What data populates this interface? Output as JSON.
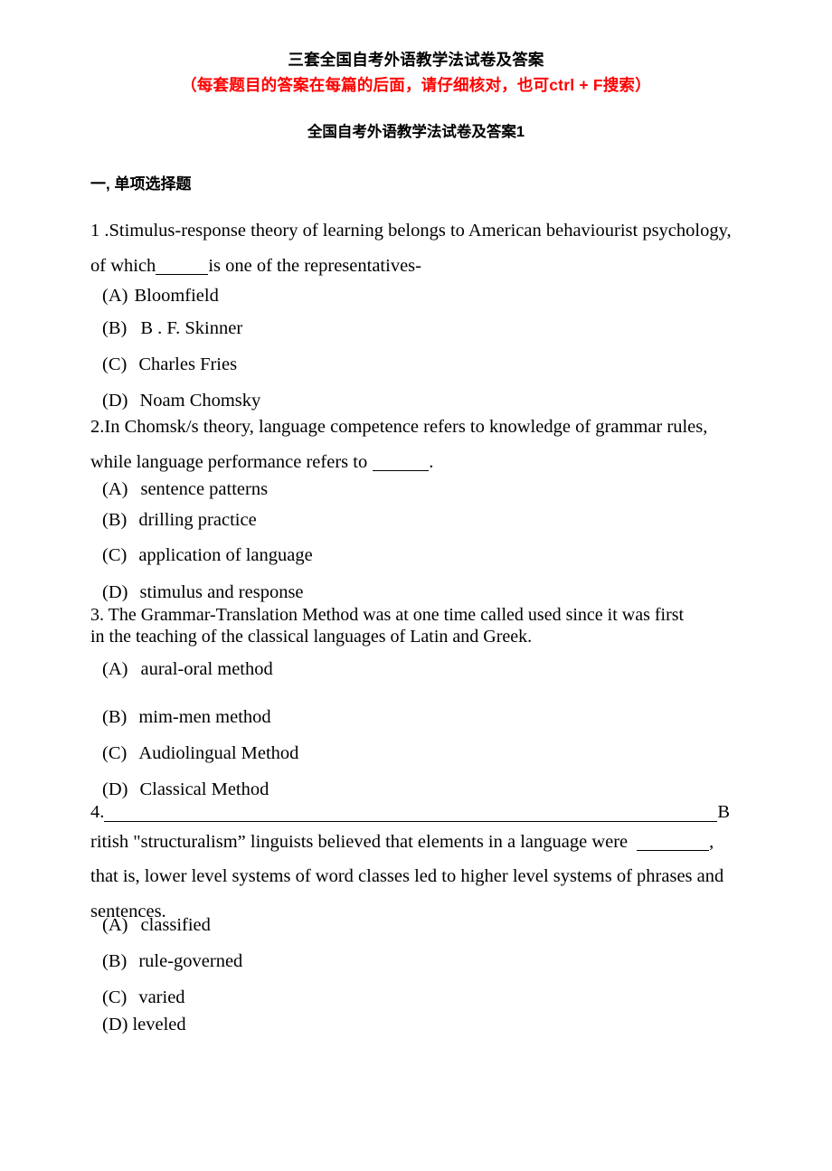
{
  "document": {
    "title": "三套全国自考外语教学法试卷及答案",
    "subnote": "（每套题目的答案在每篇的后面，请仔细核对，也可ctrl + F搜索）",
    "paper_heading": "全国自考外语教学法试卷及答案1",
    "section_heading": "一, 单项选择题"
  },
  "questions": [
    {
      "number": "1",
      "stem_line1": "1 .Stimulus-response theory of learning belongs to American behaviourist psychology,",
      "stem_line2_before": "of which",
      "stem_line2_after": "is one of the representatives-",
      "options": [
        {
          "label": "(A)",
          "text": "Bloomfield"
        },
        {
          "label": "(B)",
          "text": "B . F. Skinner"
        },
        {
          "label": "(C)",
          "text": "Charles Fries"
        },
        {
          "label": "(D)",
          "text": "Noam Chomsky"
        }
      ]
    },
    {
      "number": "2",
      "stem_line1": "2.In Chomsk/s theory, language competence refers to knowledge of grammar rules,",
      "stem_line2_before": "while language performance refers to",
      "stem_line2_after": ".",
      "options": [
        {
          "label": "(A)",
          "text": "sentence patterns"
        },
        {
          "label": "(B)",
          "text": "drilling practice"
        },
        {
          "label": "(C)",
          "text": "application of language"
        },
        {
          "label": "(D)",
          "text": "stimulus and response"
        }
      ]
    },
    {
      "number": "3",
      "stem_line1": "3.   The Grammar-Translation Method was at one time called used    since it was first",
      "stem_line2": "in the teaching of the classical languages of Latin and Greek.",
      "options": [
        {
          "label": "(A)",
          "text": "aural-oral method"
        },
        {
          "label": "(B)",
          "text": "mim-men method"
        },
        {
          "label": "(C)",
          "text": "Audiolingual Method"
        },
        {
          "label": "(D)",
          "text": "Classical Method"
        }
      ]
    },
    {
      "number": "4",
      "stem_line1_prefix": "4.",
      "stem_line1_suffix": "B",
      "stem_line2_before": "ritish \"structuralism” linguists believed that elements in a language were",
      "stem_line2_after": ",",
      "stem_line3": "that is, lower level systems of word classes led to higher level systems of phrases and",
      "stem_line4": "sentences.",
      "options": [
        {
          "label": "(A)",
          "text": "classified"
        },
        {
          "label": "(B)",
          "text": "rule-governed"
        },
        {
          "label": "(C)",
          "text": "varied"
        },
        {
          "label": "(D)",
          "text": "leveled"
        }
      ]
    }
  ]
}
